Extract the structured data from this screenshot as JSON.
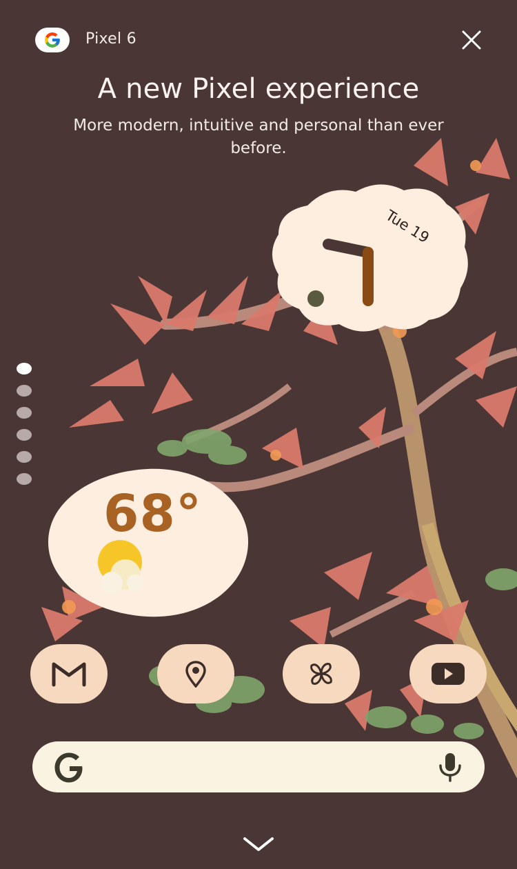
{
  "header": {
    "title": "Pixel 6",
    "logo_icon": "google-g-icon",
    "close_icon": "close-icon"
  },
  "hero": {
    "title": "A new Pixel experience",
    "subtitle": "More modern, intuitive and personal than ever before."
  },
  "pagination": {
    "count": 6,
    "active_index": 0
  },
  "clock_widget": {
    "date": "Tue 19"
  },
  "weather_widget": {
    "temperature": "68°",
    "condition_icon": "sunny-partly-cloudy-icon"
  },
  "dock_apps": [
    {
      "name": "gmail",
      "icon": "gmail-icon"
    },
    {
      "name": "maps",
      "icon": "location-pin-icon"
    },
    {
      "name": "pinwheel",
      "icon": "pinwheel-icon"
    },
    {
      "name": "youtube",
      "icon": "youtube-icon"
    }
  ],
  "search_bar": {
    "logo_icon": "google-g-icon",
    "mic_icon": "microphone-icon"
  },
  "footer": {
    "expand_icon": "chevron-down-icon"
  },
  "colors": {
    "background": "#4a3634",
    "widget_bg": "#fdeee0",
    "accent_brown": "#a86224",
    "dock_icon_bg": "#f7d9bf",
    "search_bg": "#fbf3e2"
  }
}
